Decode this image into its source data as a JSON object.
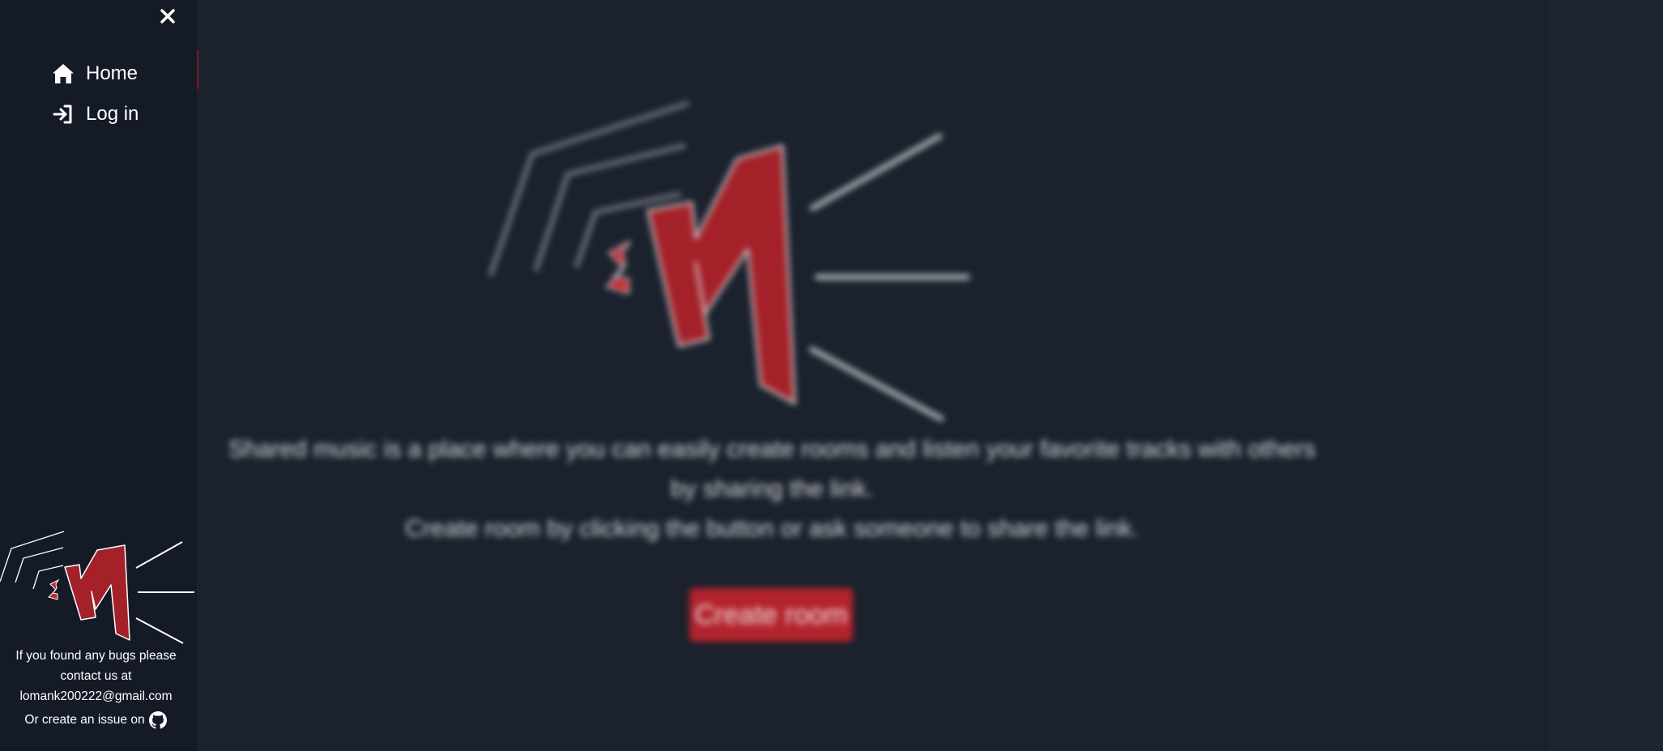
{
  "sidebar": {
    "close_label": "✕",
    "nav": [
      {
        "label": "Home",
        "icon": "home-icon"
      },
      {
        "label": "Log in",
        "icon": "login-icon"
      }
    ],
    "contact": {
      "line1": "If you found any bugs please",
      "line2": "contact us at",
      "email": "lomank200222@gmail.com",
      "issue_prefix": "Or create an issue on"
    }
  },
  "main": {
    "description_line1": "Shared music is a place where you can easily create rooms and listen your favorite tracks with others",
    "description_line2": "by sharing the link.",
    "description_line3": "Create room by clicking the button or ask someone to share the link.",
    "create_button": "Create room"
  },
  "colors": {
    "background": "#1b222d",
    "sidebar": "#151a27",
    "accent_red": "#b3232d",
    "logo_red": "#a42129"
  },
  "logo": {
    "letters": "SM"
  }
}
